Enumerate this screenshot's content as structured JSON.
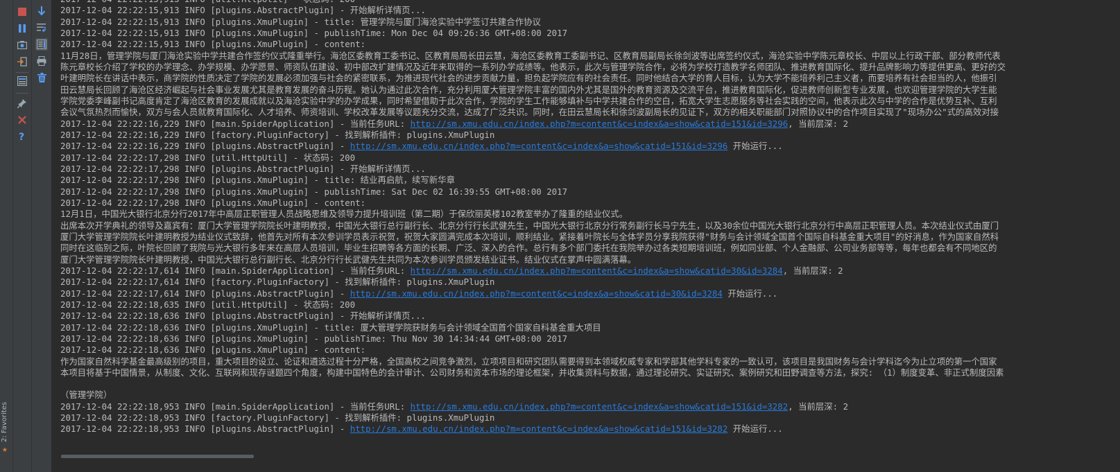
{
  "sidebar": {
    "favorites_label": "2: Favorites"
  },
  "toolbar": {
    "buttons": [
      {
        "name": "stop-button",
        "icon": "stop-icon",
        "color": "#c75450"
      },
      {
        "name": "pause-button",
        "icon": "pause-icon",
        "color": "#589df6"
      },
      {
        "name": "dump-threads-button",
        "icon": "camera-icon",
        "color": "#9aa7b0"
      },
      {
        "name": "exit-button",
        "icon": "exit-icon",
        "color": "#d77d33"
      },
      {
        "name": "settings-button",
        "icon": "layout-icon",
        "color": "#9aa7b0"
      },
      {
        "name": "pin-tab-button",
        "icon": "pin-icon",
        "color": "#9aa7b0"
      },
      {
        "name": "close-button",
        "icon": "close-icon",
        "color": "#c75450"
      },
      {
        "name": "help-button",
        "icon": "help-icon",
        "color": "#589df6"
      }
    ],
    "buttons2": [
      {
        "name": "scroll-to-end-button",
        "icon": "arrow-down-icon",
        "color": "#589df6"
      },
      {
        "name": "soft-wrap-button",
        "icon": "soft-wrap-icon",
        "color": "#9aa7b0"
      },
      {
        "name": "scroll-toggle-button",
        "icon": "scroll-icon",
        "color": "#9aa7b0",
        "selected": true
      },
      {
        "name": "print-button",
        "icon": "print-icon",
        "color": "#9aa7b0"
      },
      {
        "name": "clear-all-button",
        "icon": "trash-icon",
        "color": "#589df6"
      }
    ]
  },
  "console": {
    "link_color": "#287bde",
    "text_color": "#bbbbbb",
    "lines": [
      {
        "text": "2017-12-04 22:22:15,913 INFO [util.HttpUtil] - 状态码: 200"
      },
      {
        "text": "2017-12-04 22:22:15,913 INFO [plugins.AbstractPlugin] - 开始解析详情页..."
      },
      {
        "text": "2017-12-04 22:22:15,913 INFO [plugins.XmuPlugin] - title: 管理学院与厦门海沧实验中学签订共建合作协议"
      },
      {
        "text": "2017-12-04 22:22:15,913 INFO [plugins.XmuPlugin] - publishTime: Mon Dec 04 09:26:36 GMT+08:00 2017"
      },
      {
        "text": "2017-12-04 22:22:15,913 INFO [plugins.XmuPlugin] - content:"
      },
      {
        "text": "11月28日，管理学院与厦门海沧实验中学共建合作签约仪式隆重举行。海沧区委教育工委书记、区教育局局长田云慧，海沧区委教育工委副书记、区教育局副局长徐剑波等出席签约仪式，海沧实验中学陈元章校长、中层以上行政干部、部分教师代表"
      },
      {
        "text": "陈元章校长介绍了学校的办学理念、办学规模、办学愿景、师资队伍建设、初中部改扩建情况及近年来取得的一系列办学成绩等。他表示，此次与管理学院合作，必将为学校打造教学名师团队、推进教育国际化、提升品牌影响力等提供更高、更好的交"
      },
      {
        "text": "叶建明院长在讲话中表示，商学院的性质决定了学院的发展必须加强与社会的紧密联系，为推进现代社会的进步贡献力量，担负起学院应有的社会责任。同时他结合大学的育人目标，认为大学不能培养利己主义者，而要培养有社会担当的人，他振引"
      },
      {
        "text": "田云慧局长回顾了海沧区经济崛起与社会事业发展尤其是教育发展的奋斗历程。她认为通过此次合作，充分利用厦大管理学院丰富的国内外尤其是国外的教育资源及交流平台，推进教育国际化，促进教师创新型专业发展，也欢迎管理学院的大学生能"
      },
      {
        "text": "学院党委李峰副书记高度肯定了海沧区教育的发展成就以及海沧实验中学的办学成果，同时希望借助于此次合作，学院的学生工作能够填补与中学共建合作的空白，拓宽大学生志愿服务等社会实践的空间，他表示此次与中学的合作是优势互补、互利"
      },
      {
        "text": "会议气氛热烈而愉快，双方与会人员就教育国际化、人才培养、师资培训、学校改革发展等议题充分交流，达成了广泛共识。同时，在田云慧局长和徐剑波副局长的见证下，双方的相关职能部门对照协议中的合作项目实现了\"现场办公\"式的高效对接"
      },
      {
        "text": "2017-12-04 22:22:16,229 INFO [main.SpiderApplication] - 当前任务URL: ",
        "link": "http://sm.xmu.edu.cn/index.php?m=content&c=index&a=show&catid=151&id=3296",
        "after": ", 当前层深: 2"
      },
      {
        "text": "2017-12-04 22:22:16,229 INFO [factory.PluginFactory] - 找到解析插件: plugins.XmuPlugin"
      },
      {
        "text": "2017-12-04 22:22:16,229 INFO [plugins.AbstractPlugin] - ",
        "link": "http://sm.xmu.edu.cn/index.php?m=content&c=index&a=show&catid=151&id=3296",
        "after": " 开始运行..."
      },
      {
        "text": "2017-12-04 22:22:17,298 INFO [util.HttpUtil] - 状态码: 200"
      },
      {
        "text": "2017-12-04 22:22:17,298 INFO [plugins.AbstractPlugin] - 开始解析详情页..."
      },
      {
        "text": "2017-12-04 22:22:17,298 INFO [plugins.XmuPlugin] - title: 结业再启航，续写新华章"
      },
      {
        "text": "2017-12-04 22:22:17,298 INFO [plugins.XmuPlugin] - publishTime: Sat Dec 02 16:39:55 GMT+08:00 2017"
      },
      {
        "text": "2017-12-04 22:22:17,298 INFO [plugins.XmuPlugin] - content:"
      },
      {
        "text": "12月1日，中国光大银行北京分行2017年中高层正职管理人员战略思维及领导力提升培训班（第二期）于保欣丽英楼102教室举办了隆重的结业仪式。"
      },
      {
        "text": "出席本次开学典礼的领导及嘉宾有：厦门大学管理学院院长叶建明教授，中国光大银行总行副行长、北京分行行长武健先生，中国光大银行北京分行常务副行长马宁先生，以及30余位中国光大银行北京分行中高层正职管理人员。本次结业仪式由厦门"
      },
      {
        "text": "厦门大学管理学院院长叶建明教授为结业仪式致辞，他首先对所有本次参训学员表示祝贺，祝贺大家圆满完成本次培训，顺利结业。紧接着叶院长与全体学员分享我院获得\"财务与会计领域全国首个国际自科基金重大项目\"的好消息，作为国家自然科"
      },
      {
        "text": "同时在这临别之际，叶院长回顾了我院与光大银行多年来在高层人员培训，毕业生招聘等各方面的长期、广泛、深入的合作。总行有多个部门委托在我院举办过各类短期培训班，例如同业部、个人金融部、公司业务部等等，每年也都会有不同地区的"
      },
      {
        "text": "厦门大学管理学院院长叶建明教授，中国光大银行总行副行长、北京分行行长武健先生共同为本次参训学员颁发结业证书。结业仪式在掌声中圆满落幕。"
      },
      {
        "text": "2017-12-04 22:22:17,614 INFO [main.SpiderApplication] - 当前任务URL: ",
        "link": "http://sm.xmu.edu.cn/index.php?m=content&c=index&a=show&catid=30&id=3284",
        "after": ", 当前层深: 2"
      },
      {
        "text": "2017-12-04 22:22:17,614 INFO [factory.PluginFactory] - 找到解析插件: plugins.XmuPlugin"
      },
      {
        "text": "2017-12-04 22:22:17,614 INFO [plugins.AbstractPlugin] - ",
        "link": "http://sm.xmu.edu.cn/index.php?m=content&c=index&a=show&catid=30&id=3284",
        "after": " 开始运行..."
      },
      {
        "text": "2017-12-04 22:22:18,635 INFO [util.HttpUtil] - 状态码: 200"
      },
      {
        "text": "2017-12-04 22:22:18,636 INFO [plugins.AbstractPlugin] - 开始解析详情页..."
      },
      {
        "text": "2017-12-04 22:22:18,636 INFO [plugins.XmuPlugin] - title: 厦大管理学院获财务与会计领域全国首个国家自科基金重大项目"
      },
      {
        "text": "2017-12-04 22:22:18,636 INFO [plugins.XmuPlugin] - publishTime: Thu Nov 30 14:34:44 GMT+08:00 2017"
      },
      {
        "text": "2017-12-04 22:22:18,636 INFO [plugins.XmuPlugin] - content:"
      },
      {
        "text": "作为国家自然科学基金最高级别的项目，重大项目的设立、论证和遴选过程十分严格，全国高校之间竞争激烈，立项项目和研究团队需要得到本领域权威专家和学部其他学科专家的一致认可，该项目是我国财务与会计学科迄今为止立项的第一个国家"
      },
      {
        "text": "本项目将基于中国情景，从制度、文化、互联网和现存谜题四个角度，构建中国特色的会计审计、公司财务和资本市场的理论框架，并收集资料与数据，通过理论研究、实证研究、案例研究和田野调查等方法，探究: （1）制度变革、非正式制度因素"
      },
      {
        "text": ""
      },
      {
        "text": "（管理学院）"
      },
      {
        "text": "2017-12-04 22:22:18,953 INFO [main.SpiderApplication] - 当前任务URL: ",
        "link": "http://sm.xmu.edu.cn/index.php?m=content&c=index&a=show&catid=151&id=3282",
        "after": ", 当前层深: 2"
      },
      {
        "text": "2017-12-04 22:22:18,953 INFO [factory.PluginFactory] - 找到解析插件: plugins.XmuPlugin"
      },
      {
        "text": "2017-12-04 22:22:18,953 INFO [plugins.AbstractPlugin] - ",
        "link": "http://sm.xmu.edu.cn/index.php?m=content&c=index&a=show&catid=151&id=3282",
        "after": " 开始运行..."
      }
    ]
  }
}
